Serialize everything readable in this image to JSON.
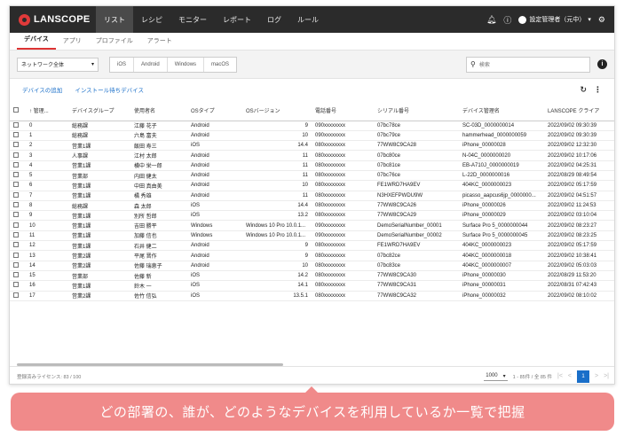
{
  "app": {
    "logo": "LANSCOPE"
  },
  "nav": {
    "items": [
      "リスト",
      "レシピ",
      "モニター",
      "レポート",
      "ログ",
      "ルール"
    ],
    "user": "設定管理者（元中）"
  },
  "subtabs": [
    "デバイス",
    "アプリ",
    "プロファイル",
    "アラート"
  ],
  "filters": {
    "group_select": "ネットワーク全体",
    "os_buttons": [
      "iOS",
      "Android",
      "Windows",
      "macOS"
    ],
    "search_placeholder": "検索"
  },
  "actions": {
    "add_device": "デバイスの追加",
    "install_pending": "インストール待ちデバイス"
  },
  "table": {
    "headers": [
      "管理...",
      "デバイスグループ",
      "使用者名",
      "OSタイプ",
      "OSバージョン",
      "電話番号",
      "シリアル番号",
      "デバイス管理名",
      "LANSCOPE クライア"
    ],
    "rows": [
      [
        "0",
        "総務課",
        "江藤 花子",
        "Android",
        "9",
        "090xxxxxxxx",
        "07bc78ce",
        "SC-03D_0000000014",
        "2022/09/02 09:30:39"
      ],
      [
        "1",
        "総務課",
        "六島 富夫",
        "Android",
        "10",
        "090xxxxxxxx",
        "07bc79ce",
        "hammerhead_0000000059",
        "2022/09/02 09:30:39"
      ],
      [
        "2",
        "営業1課",
        "飯田 寿三",
        "iOS",
        "14.4",
        "080xxxxxxxx",
        "77WW8C9CA28",
        "iPhone_00000028",
        "2022/09/02 12:32:30"
      ],
      [
        "3",
        "人事課",
        "江村 太郎",
        "Android",
        "11",
        "080xxxxxxxx",
        "07bc80ce",
        "N-04C_0000000020",
        "2022/09/02 10:17:06"
      ],
      [
        "4",
        "営業1課",
        "横中 栄一郎",
        "Android",
        "11",
        "080xxxxxxxx",
        "07bc81ce",
        "EB-A710J_0000000019",
        "2022/09/02 04:25:31"
      ],
      [
        "5",
        "営業部",
        "内田 健太",
        "Android",
        "11",
        "080xxxxxxxx",
        "07bc76ce",
        "L-22D_0000000016",
        "2022/08/29 08:49:54"
      ],
      [
        "6",
        "営業1課",
        "中田 真由美",
        "Android",
        "10",
        "080xxxxxxxx",
        "FE1WRD7HA9EV",
        "404KC_0000000023",
        "2022/09/02 05:17:59"
      ],
      [
        "7",
        "営業1課",
        "橘 秀雄",
        "Android",
        "11",
        "080xxxxxxxx",
        "N3HXEFPWDU9W",
        "picasso_aapcus6jp_0000000...",
        "2022/09/02 04:51:57"
      ],
      [
        "8",
        "総務課",
        "森 太郎",
        "iOS",
        "14.4",
        "080xxxxxxxx",
        "77WW8C9CA26",
        "iPhone_00000026",
        "2022/09/02 11:24:53"
      ],
      [
        "9",
        "営業1課",
        "別所 哲郎",
        "iOS",
        "13.2",
        "080xxxxxxxx",
        "77WW8C9CA29",
        "iPhone_00000029",
        "2022/09/02 03:10:04"
      ],
      [
        "10",
        "営業1課",
        "吉田 勝平",
        "Windows",
        "Windows 10 Pro 10.0.1...",
        "090xxxxxxxx",
        "DemoSerialNumber_00001",
        "Surface Pro 5_0000000044",
        "2022/09/02 08:23:27"
      ],
      [
        "11",
        "営業1課",
        "加藤 信也",
        "Windows",
        "Windows 10 Pro 10.0.1...",
        "090xxxxxxxx",
        "DemoSerialNumber_00002",
        "Surface Pro 5_0000000045",
        "2022/09/02 08:23:25"
      ],
      [
        "12",
        "営業1課",
        "石井 健二",
        "Android",
        "9",
        "080xxxxxxxx",
        "FE1WRD7HA9EV",
        "404KC_0000000023",
        "2022/09/02 05:17:59"
      ],
      [
        "13",
        "営業2課",
        "平尾 晋作",
        "Android",
        "9",
        "080xxxxxxxx",
        "07bc82ce",
        "404KC_0000000018",
        "2022/09/02 10:38:41"
      ],
      [
        "14",
        "営業2課",
        "佐藤 瑞恵子",
        "Android",
        "10",
        "080xxxxxxxx",
        "07bc83ce",
        "404KC_0000000007",
        "2022/09/02 05:03:03"
      ],
      [
        "15",
        "営業部",
        "佐藤 新",
        "iOS",
        "14.2",
        "080xxxxxxxx",
        "77WW8C9CA30",
        "iPhone_00000030",
        "2022/08/29 11:53:20"
      ],
      [
        "16",
        "営業1課",
        "鈴木 一",
        "iOS",
        "14.1",
        "080xxxxxxxx",
        "77WW8C9CA31",
        "iPhone_00000031",
        "2022/08/31 07:42:43"
      ],
      [
        "17",
        "営業2課",
        "佐竹 信弘",
        "iOS",
        "13.5.1",
        "080xxxxxxxx",
        "77WW8C9CA32",
        "iPhone_00000032",
        "2022/09/02 08:10:02"
      ]
    ]
  },
  "footer": {
    "license": "登録済みライセンス: 83 / 100",
    "per_page": "1000",
    "range": "1 - 85件 / 全 85 件",
    "current_page": "1"
  },
  "caption": "どの部署の、誰が、どのようなデバイスを利用しているか一覧で把握"
}
